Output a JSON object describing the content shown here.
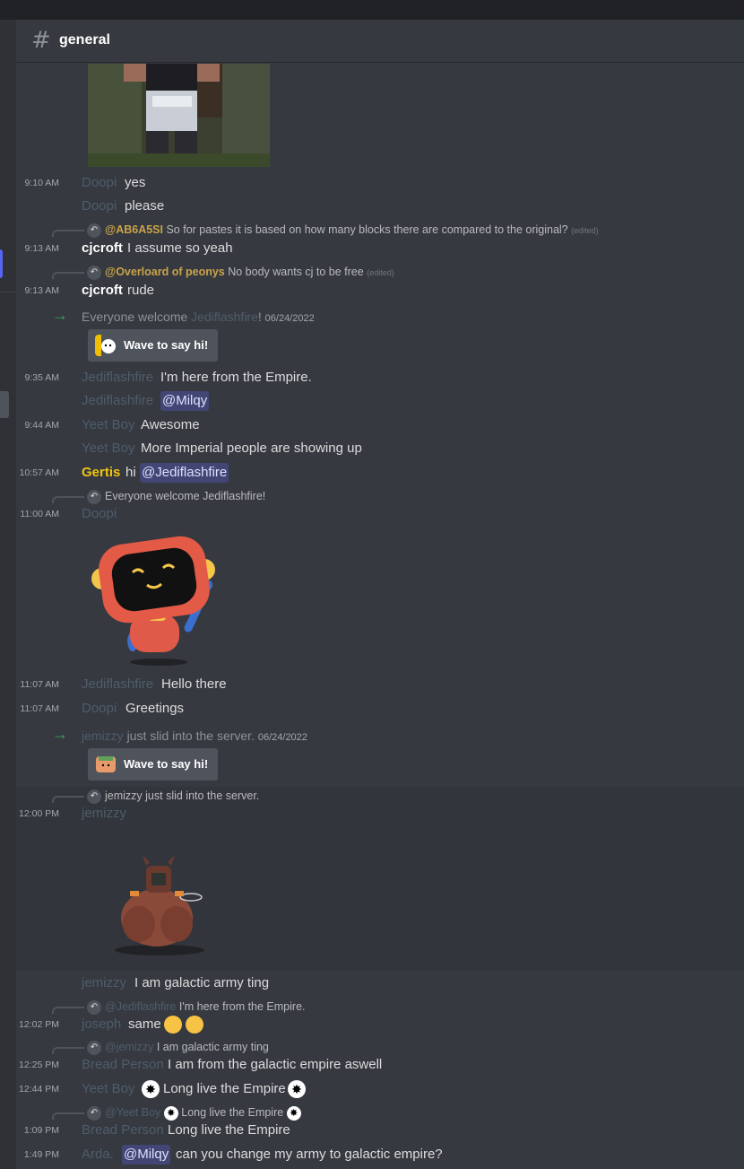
{
  "channel": {
    "hash": "#",
    "name": "general"
  },
  "messages": [
    {
      "time": "9:10 AM",
      "author": "Doopi",
      "text": "yes"
    },
    {
      "author": "Doopi",
      "text": "please"
    },
    {
      "reply_to": "@AB6A5SI",
      "reply_text": "So for pastes it is based on how many blocks there are compared to the original?",
      "reply_edited": "(edited)",
      "time": "9:13 AM",
      "author": "cjcroft",
      "text": "I assume so yeah"
    },
    {
      "reply_to": "@Overloard of peonys",
      "reply_text": "No body wants cj to be free",
      "reply_edited": "(edited)",
      "time": "9:13 AM",
      "author": "cjcroft",
      "text": "rude"
    },
    {
      "system": "Everyone welcome",
      "system_name": "Jediflashfire",
      "system_end": "!",
      "date": "06/24/2022",
      "wave": "Wave to say hi!"
    },
    {
      "time": "9:35 AM",
      "author": "Jediflashfire",
      "text": "I'm here from the Empire."
    },
    {
      "author": "Jediflashfire",
      "mention": "@Milqy"
    },
    {
      "time": "9:44 AM",
      "author": "Yeet Boy",
      "text": "Awesome"
    },
    {
      "author": "Yeet Boy",
      "text": "More Imperial people are showing up"
    },
    {
      "time": "10:57 AM",
      "author": "Gertis",
      "text": "hi",
      "mention": "@Jediflashfire"
    },
    {
      "reply_text": "Everyone welcome Jediflashfire!",
      "time": "11:00 AM",
      "author": "Doopi",
      "sticker": "robot-wave-sticker"
    },
    {
      "time": "11:07 AM",
      "author": "Jediflashfire",
      "text": "Hello there"
    },
    {
      "time": "11:07 AM",
      "author": "Doopi",
      "text": "Greetings"
    },
    {
      "system_name": "jemizzy",
      "system_end": "just slid into the server.",
      "date": "06/24/2022",
      "wave": "Wave to say hi!"
    },
    {
      "reply_text": "jemizzy just slid into the server.",
      "time": "12:00 PM",
      "author": "jemizzy",
      "sticker": "critter-sticker"
    },
    {
      "author": "jemizzy",
      "text": "I am galactic army ting"
    },
    {
      "reply_to": "@Jediflashfire",
      "reply_text": "I'm here from the Empire.",
      "time": "12:02 PM",
      "author": "joseph",
      "text": "same"
    },
    {
      "reply_to": "@jemizzy",
      "reply_text": "I am galactic army ting",
      "time": "12:25 PM",
      "author": "Bread Person",
      "text": "I am from the galactic empire aswell"
    },
    {
      "time": "12:44 PM",
      "author": "Yeet Boy",
      "text": "Long live the Empire"
    },
    {
      "reply_to": "@Yeet Boy",
      "reply_text": "Long live the Empire",
      "time": "1:09 PM",
      "author": "Bread Person",
      "text": "Long live the Empire"
    },
    {
      "time": "1:49 PM",
      "author": "Arda.",
      "mention": "@Milqy",
      "text": "can you change my army to galactic empire?"
    }
  ]
}
